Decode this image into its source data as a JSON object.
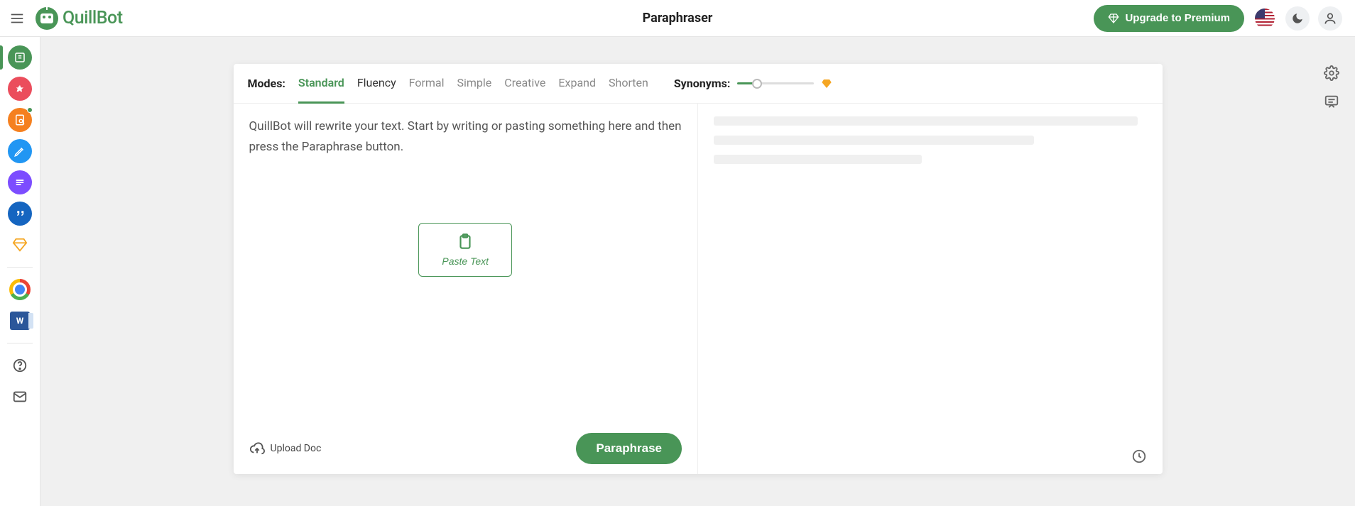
{
  "header": {
    "brand": "QuillBot",
    "page_title": "Paraphraser",
    "premium_label": "Upgrade to Premium"
  },
  "sidebar": {
    "items": [
      {
        "name": "paraphraser",
        "color": "#499557"
      },
      {
        "name": "grammar-checker",
        "color": "#eb4d5c"
      },
      {
        "name": "plagiarism-checker",
        "color": "#f5801f"
      },
      {
        "name": "co-writer",
        "color": "#2196f3"
      },
      {
        "name": "summarizer",
        "color": "#7c4dff"
      },
      {
        "name": "citation-generator",
        "color": "#1565c0"
      }
    ]
  },
  "modes": {
    "label": "Modes:",
    "items": [
      "Standard",
      "Fluency",
      "Formal",
      "Simple",
      "Creative",
      "Expand",
      "Shorten"
    ],
    "active": "Standard",
    "synonyms_label": "Synonyms:"
  },
  "editor": {
    "placeholder": "QuillBot will rewrite your text. Start by writing or pasting something here and then press the Paraphrase button.",
    "paste_label": "Paste Text",
    "upload_label": "Upload Doc",
    "paraphrase_label": "Paraphrase"
  },
  "word_label": "W"
}
